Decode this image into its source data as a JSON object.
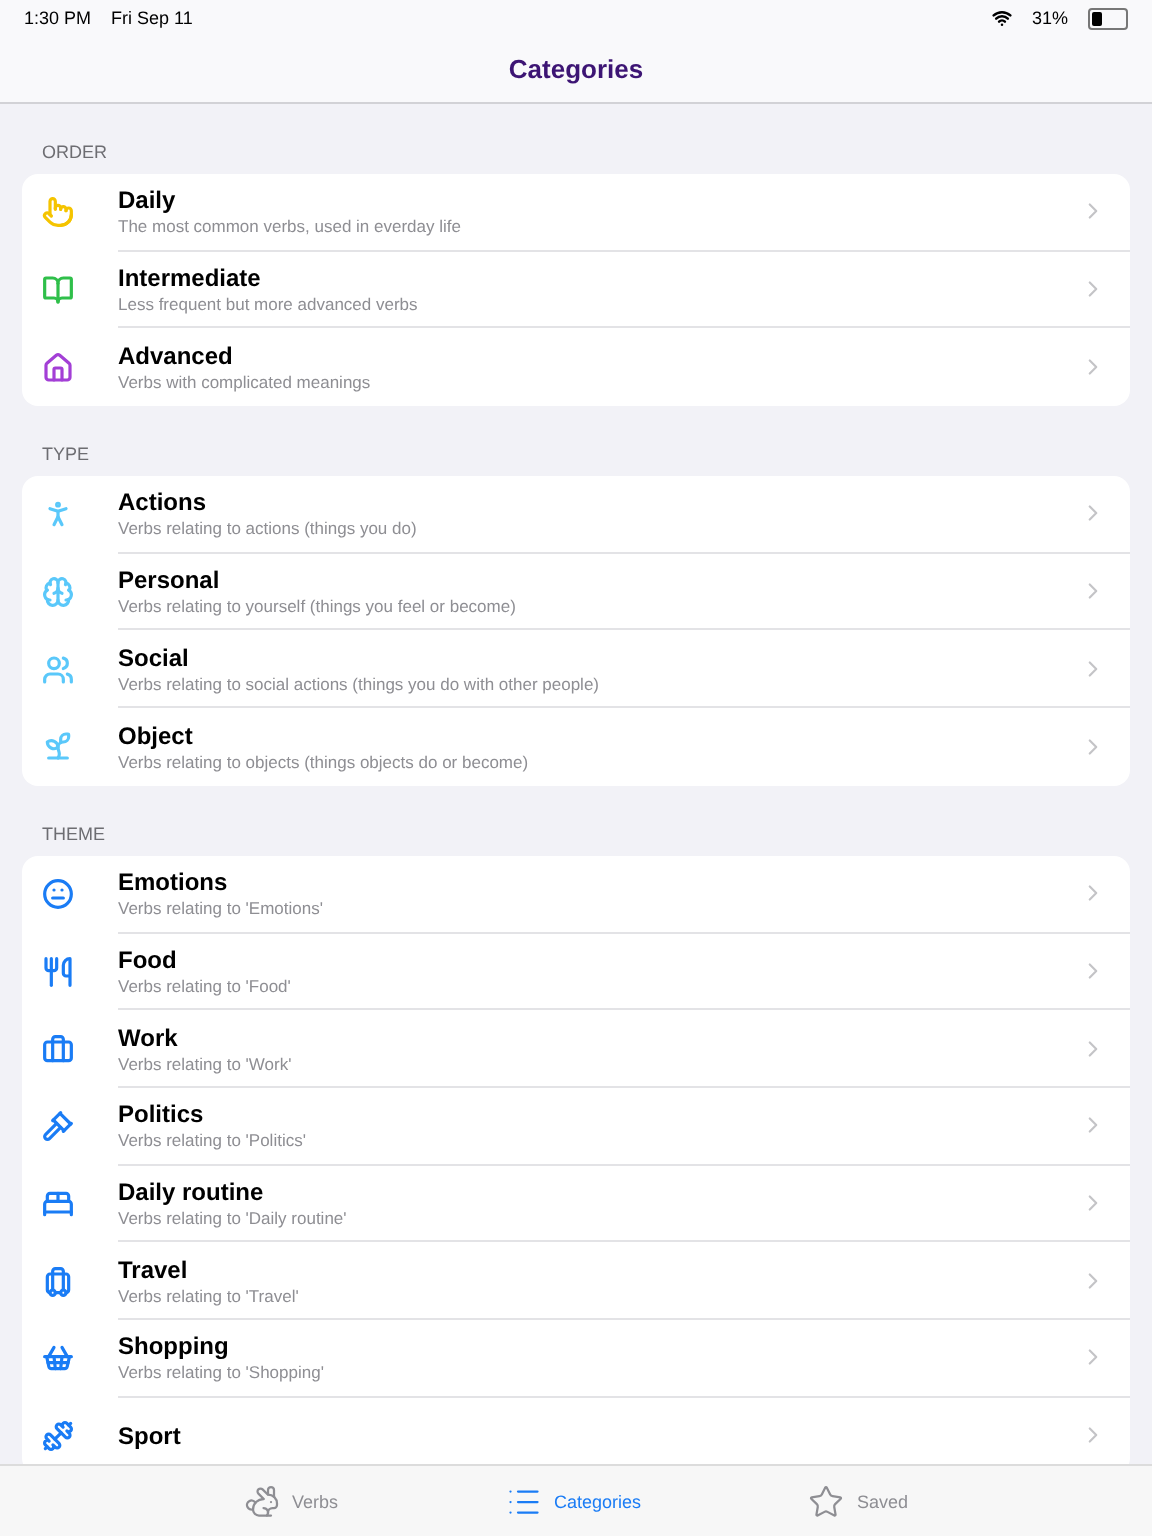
{
  "status_bar": {
    "time": "1:30 PM",
    "date": "Fri Sep 11",
    "battery": "31%"
  },
  "title": "Categories",
  "sections": [
    {
      "header": "ORDER",
      "rows": [
        {
          "title": "Daily",
          "subtitle": "The most common verbs, used in everday life"
        },
        {
          "title": "Intermediate",
          "subtitle": "Less frequent but more advanced verbs"
        },
        {
          "title": "Advanced",
          "subtitle": "Verbs with complicated meanings"
        }
      ]
    },
    {
      "header": "TYPE",
      "rows": [
        {
          "title": "Actions",
          "subtitle": "Verbs relating to actions (things you do)"
        },
        {
          "title": "Personal",
          "subtitle": "Verbs relating to yourself (things you feel or become)"
        },
        {
          "title": "Social",
          "subtitle": "Verbs relating to social actions (things you do with other people)"
        },
        {
          "title": "Object",
          "subtitle": "Verbs relating to objects (things objects do or become)"
        }
      ]
    },
    {
      "header": "THEME",
      "rows": [
        {
          "title": "Emotions",
          "subtitle": "Verbs relating to 'Emotions'"
        },
        {
          "title": "Food",
          "subtitle": "Verbs relating to 'Food'"
        },
        {
          "title": "Work",
          "subtitle": "Verbs relating to 'Work'"
        },
        {
          "title": "Politics",
          "subtitle": "Verbs relating to 'Politics'"
        },
        {
          "title": "Daily routine",
          "subtitle": "Verbs relating to 'Daily routine'"
        },
        {
          "title": "Travel",
          "subtitle": "Verbs relating to 'Travel'"
        },
        {
          "title": "Shopping",
          "subtitle": "Verbs relating to 'Shopping'"
        },
        {
          "title": "Sport"
        }
      ]
    }
  ],
  "tabs": [
    {
      "label": "Verbs",
      "selected": false
    },
    {
      "label": "Categories",
      "selected": true
    },
    {
      "label": "Saved",
      "selected": false
    }
  ]
}
